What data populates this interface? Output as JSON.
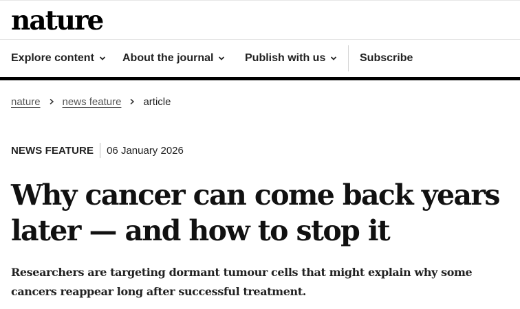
{
  "header": {
    "logo": "nature"
  },
  "nav": {
    "items": [
      {
        "label": "Explore content",
        "has_dropdown": true
      },
      {
        "label": "About the journal",
        "has_dropdown": true
      },
      {
        "label": "Publish with us",
        "has_dropdown": true
      }
    ],
    "subscribe_label": "Subscribe"
  },
  "breadcrumb": {
    "items": [
      "nature",
      "news feature"
    ],
    "current": "article"
  },
  "article": {
    "type": "NEWS FEATURE",
    "date": "06 January 2026",
    "title": "Why cancer can come back years later — and how to stop it",
    "standfirst": "Researchers are targeting dormant tumour cells that might explain why some cancers reappear long after successful treatment."
  },
  "icons": {
    "dropdown": "chevron-down-icon",
    "breadcrumb_separator": "chevron-right-icon"
  },
  "colors": {
    "text": "#222222",
    "rule": "#000000",
    "link": "#555555"
  }
}
